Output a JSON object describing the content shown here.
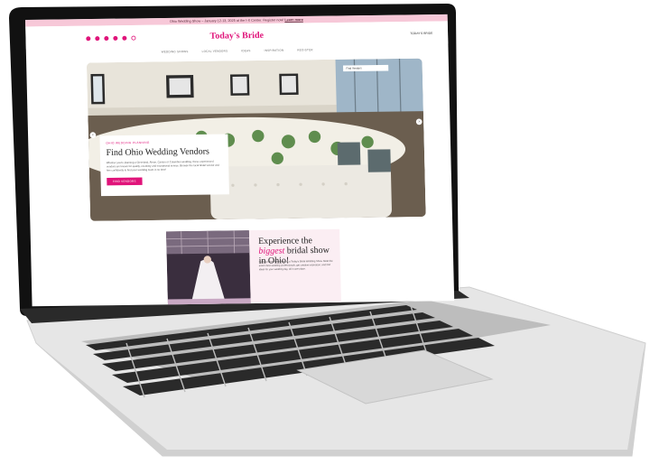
{
  "announcement": {
    "text": "Ohio Wedding Show – January 12-13, 2025 at the I-X Center. Register now!",
    "link": "Learn more"
  },
  "header": {
    "logo": "Today's Bride",
    "right_link": "TODAY'S BRIDE"
  },
  "nav": {
    "items": [
      "WEDDING SHOWS",
      "LOCAL VENDORS",
      "IDEAS",
      "INSPIRATION",
      "REGISTER"
    ]
  },
  "hero": {
    "eyebrow": "OHIO WEDDING PLANNING",
    "title": "Find Ohio Wedding Vendors",
    "body": "Whether you're planning a Cleveland, Akron, Canton or Columbus wedding, these experienced vendors are known for quality, creativity and exceptional service. Browse the local bridal vendor and hire confidently to find your wedding team in no time!",
    "button": "FIND VENDORS",
    "pill": "Find Vendors"
  },
  "promo": {
    "title_pre": "Experience the ",
    "title_script": "biggest",
    "title_post": " bridal show in Ohio!",
    "body": "Nothing beats the energy at a Today's Bride Wedding Show. Meet the area's best wedding professionals, get creative inspiration, and find ideas for your wedding day, all in one place."
  },
  "colors": {
    "accent": "#e0147a",
    "announce_bg": "#f7c8d8"
  }
}
